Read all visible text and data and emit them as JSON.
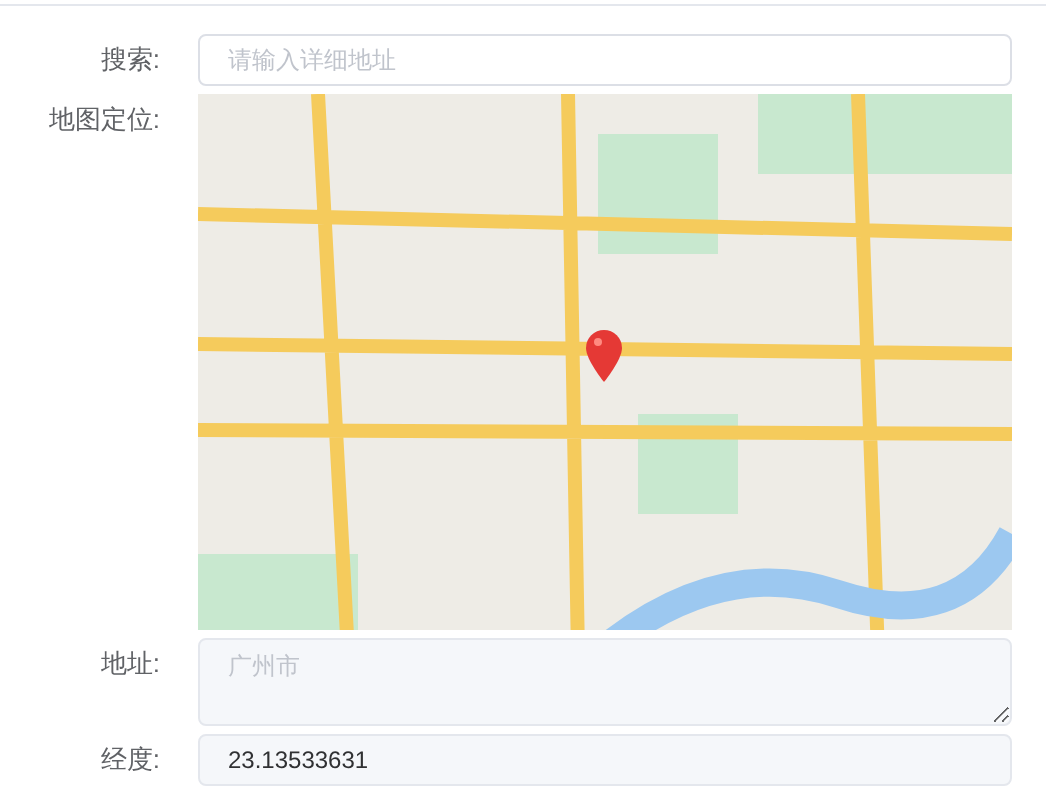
{
  "form": [
    {
      "kind": "search",
      "label": "搜索:",
      "placeholder": "请输入详细地址"
    },
    {
      "kind": "map",
      "label": "地图定位:"
    },
    {
      "kind": "textarea",
      "label": "地址:",
      "value": "广州市",
      "disabled": true
    },
    {
      "kind": "readonly",
      "label": "经度:",
      "value": "23.13533631"
    }
  ]
}
